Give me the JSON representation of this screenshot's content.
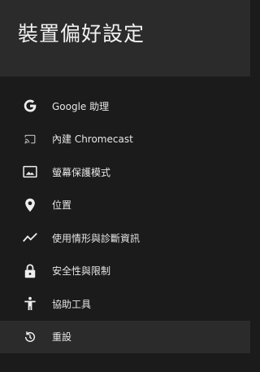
{
  "header": {
    "title": "裝置偏好設定"
  },
  "menu": {
    "items": [
      {
        "label": "Google 助理",
        "icon": "google-icon"
      },
      {
        "label": "內建 Chromecast",
        "icon": "cast-icon"
      },
      {
        "label": "螢幕保護模式",
        "icon": "screensaver-icon"
      },
      {
        "label": "位置",
        "icon": "location-pin-icon"
      },
      {
        "label": "使用情形與診斷資訊",
        "icon": "trend-icon"
      },
      {
        "label": "安全性與限制",
        "icon": "lock-icon"
      },
      {
        "label": "協助工具",
        "icon": "accessibility-icon"
      },
      {
        "label": "重設",
        "icon": "restore-icon",
        "selected": true
      }
    ]
  },
  "colors": {
    "background": "#1b1b1b",
    "header": "#2b2b2b",
    "selected_row": "#2b2b2b",
    "text": "#e6e6e6"
  }
}
